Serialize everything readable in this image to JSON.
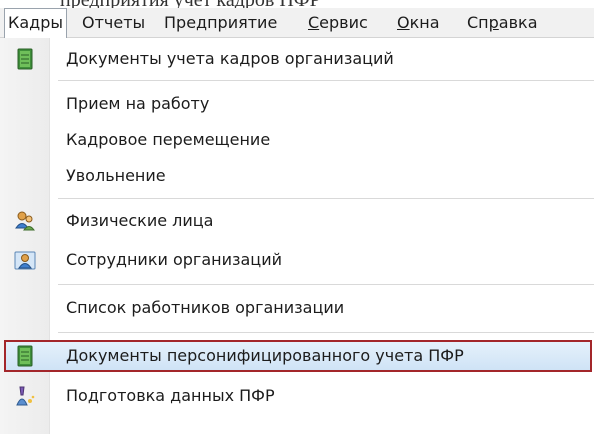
{
  "menubar": {
    "items": [
      {
        "label": "Кадры",
        "active": true
      },
      {
        "label": "Отчеты"
      },
      {
        "label": "Предприятие"
      },
      {
        "label": "Сервис"
      },
      {
        "label": "Окна"
      },
      {
        "label": "Справка"
      }
    ]
  },
  "menu": {
    "items": [
      {
        "label": "Документы учета кадров организаций",
        "icon": "green-document-icon"
      },
      {
        "label": "Прием на работу"
      },
      {
        "label": "Кадровое перемещение"
      },
      {
        "label": "Увольнение"
      },
      {
        "label": "Физические лица",
        "icon": "people-icon"
      },
      {
        "label": "Сотрудники организаций",
        "icon": "employees-icon"
      },
      {
        "label": "Список работников организации"
      },
      {
        "label": "Документы персонифицированного учета ПФР",
        "icon": "green-document-icon",
        "highlighted": true
      },
      {
        "label": "Подготовка данных ПФР",
        "icon": "wizard-icon"
      }
    ]
  },
  "colors": {
    "highlight_border": "#a3262a",
    "highlight_fill": "#d9eaf8",
    "menubar_bg": "#f1f1f1"
  }
}
